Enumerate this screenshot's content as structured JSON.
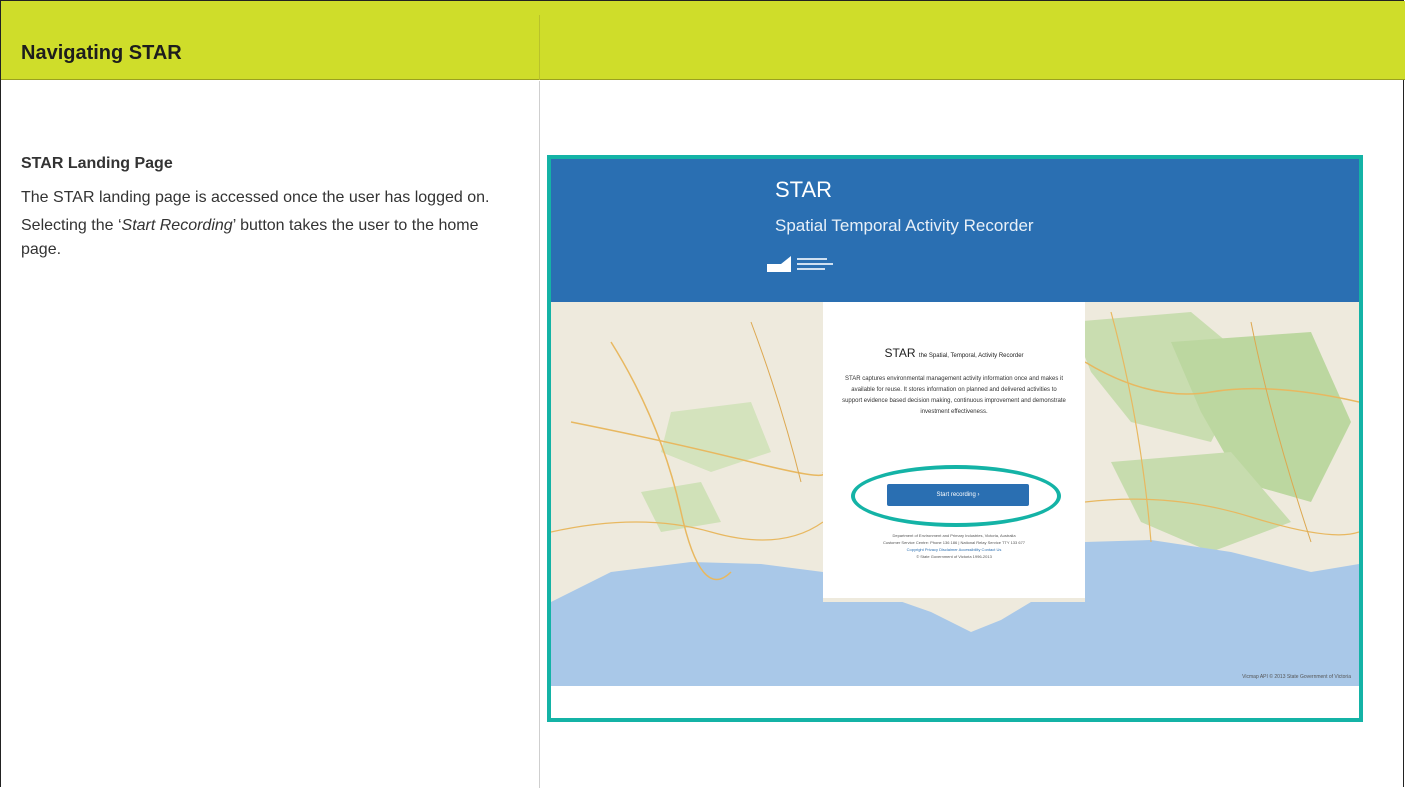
{
  "header": {
    "title": "Navigating STAR"
  },
  "left": {
    "section_title": "STAR Landing Page",
    "para1": "The STAR landing page is accessed once the user has logged on.",
    "para2_pre": "Selecting the ‘",
    "para2_em": "Start Recording",
    "para2_post": "’ button takes the user to the home page."
  },
  "screenshot": {
    "banner_title": "STAR",
    "banner_subtitle": "Spatial Temporal Activity Recorder",
    "card_title_big": "STAR",
    "card_title_small": "the Spatial, Temporal, Activity Recorder",
    "card_body": "STAR captures environmental management activity information once and makes it available for reuse. It stores information on planned and delivered activities to support evidence based decision making, continuous improvement and demonstrate investment effectiveness.",
    "start_button": "Start recording ›",
    "footer_line1": "Department of Environment and Primary Industries, Victoria, Australia",
    "footer_line2": "Customer Service Centre: Phone 136 186 | National Relay Service TTY 133 677",
    "footer_links": "Copyright   Privacy   Disclaimer   Accessibility   Contact Us",
    "footer_copy": "© State Government of Victoria 1996-2013",
    "map_caption": "Vicmap API © 2013 State Government of Victoria",
    "colors": {
      "accent_frame": "#14b3a6",
      "banner": "#2a6fb2",
      "header": "#cfdd2a"
    }
  }
}
